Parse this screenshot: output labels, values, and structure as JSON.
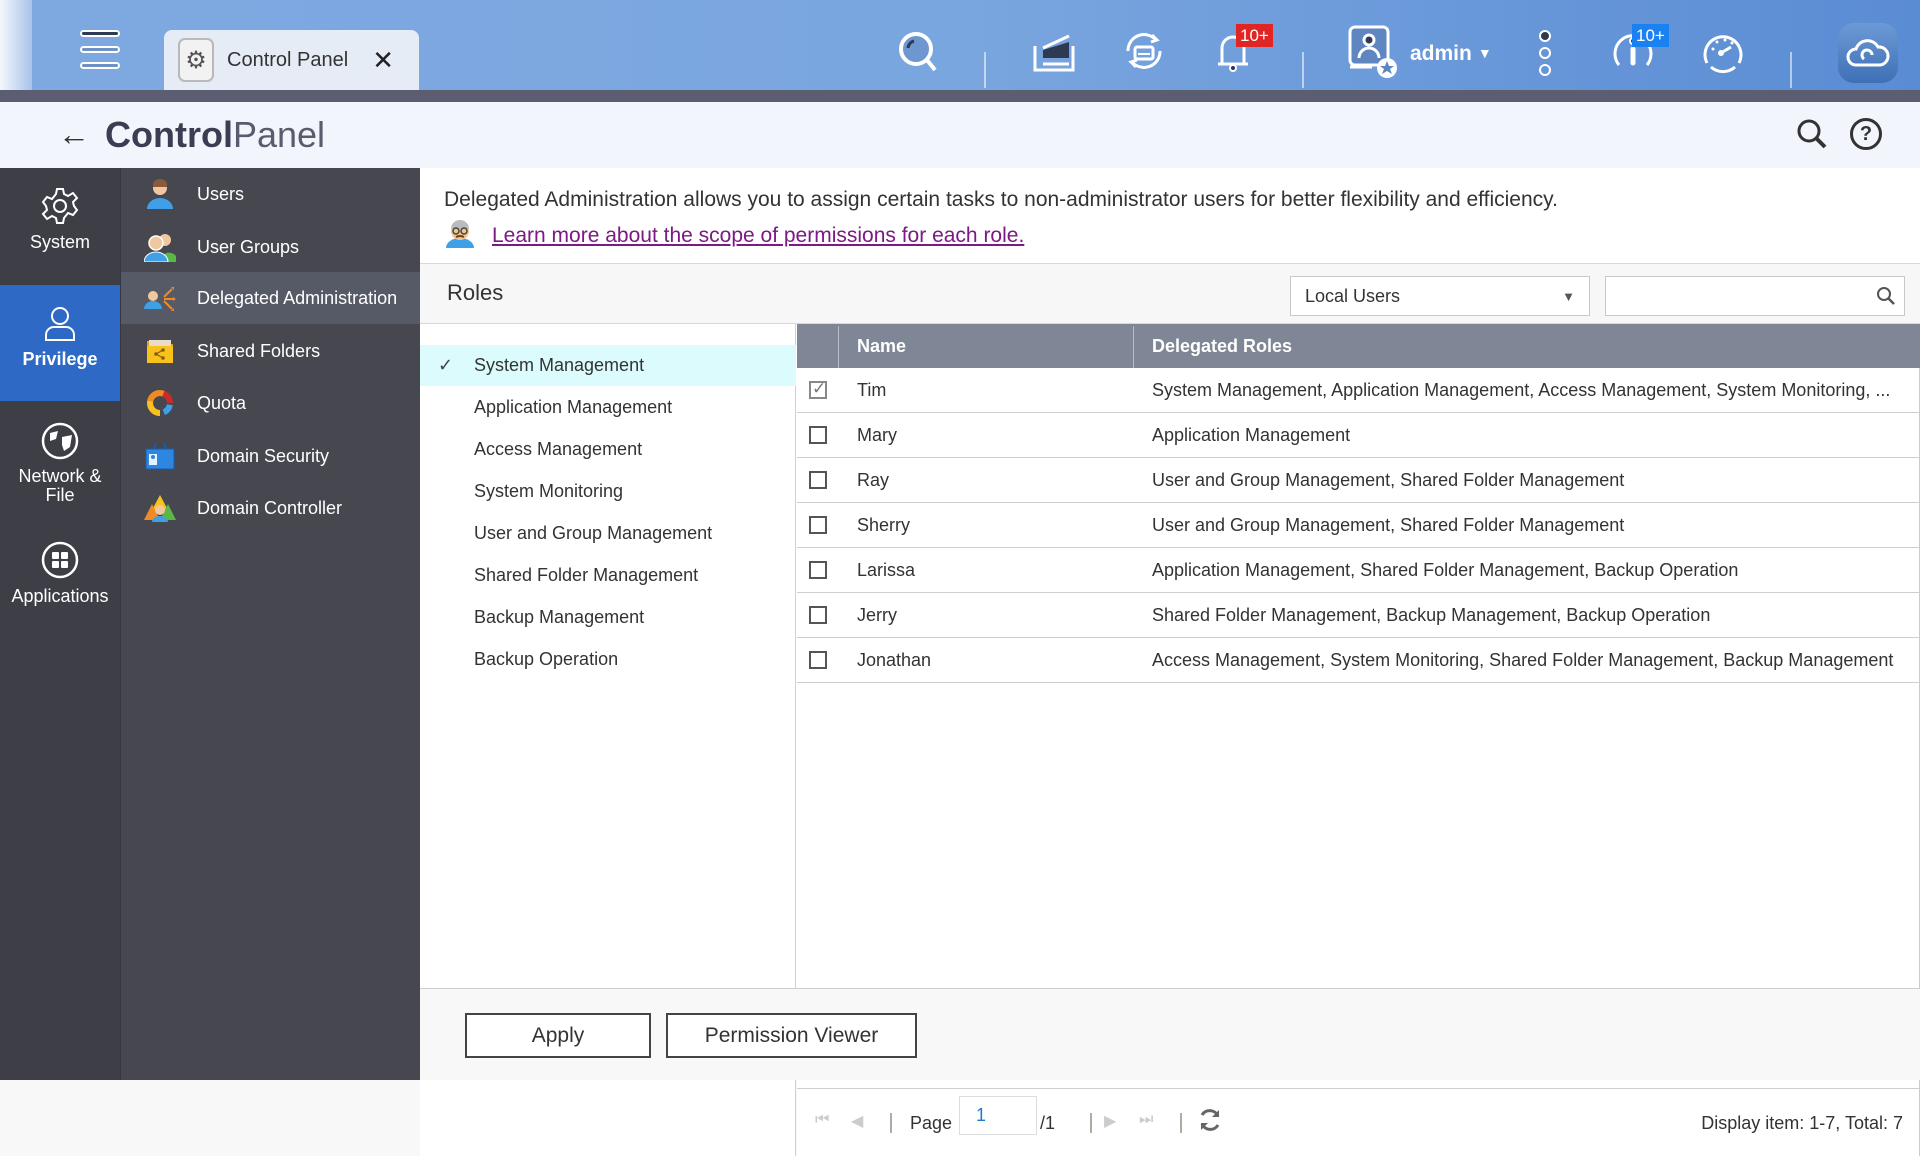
{
  "topbar": {
    "app_tab": {
      "label": "Control Panel",
      "icon": "gear-icon",
      "close_icon": "close-icon"
    },
    "icons": [
      {
        "name": "search-icon"
      },
      {
        "name": "background-tasks-icon"
      },
      {
        "name": "external-device-icon"
      },
      {
        "name": "notifications-icon",
        "badge": "10+",
        "badge_color": "#e02525"
      },
      {
        "name": "user-icon"
      },
      {
        "name": "more-options-icon"
      },
      {
        "name": "info-icon",
        "badge": "10+",
        "badge_color": "#1a82f0"
      },
      {
        "name": "dashboard-icon"
      },
      {
        "name": "cloud-icon"
      }
    ],
    "user": {
      "name": "admin"
    }
  },
  "titlebar": {
    "title_bold": "Control",
    "title_light": "Panel"
  },
  "rail": {
    "items": [
      {
        "label": "System",
        "icon": "gear-icon",
        "active": false
      },
      {
        "label": "Privilege",
        "icon": "user-icon",
        "active": true
      },
      {
        "label": "Network & File",
        "icon": "globe-icon",
        "active": false
      },
      {
        "label": "Applications",
        "icon": "apps-icon",
        "active": false
      }
    ]
  },
  "submenu": {
    "items": [
      {
        "label": "Users",
        "icon": "user-icon",
        "active": false
      },
      {
        "label": "User Groups",
        "icon": "user-groups-icon",
        "active": false
      },
      {
        "label": "Delegated Administration",
        "icon": "delegate-icon",
        "active": true
      },
      {
        "label": "Shared Folders",
        "icon": "shared-folder-icon",
        "active": false
      },
      {
        "label": "Quota",
        "icon": "quota-icon",
        "active": false
      },
      {
        "label": "Domain Security",
        "icon": "domain-security-icon",
        "active": false
      },
      {
        "label": "Domain Controller",
        "icon": "domain-controller-icon",
        "active": false
      }
    ]
  },
  "main": {
    "description": "Delegated Administration allows you to assign certain tasks to non-administrator users for better flexibility and efficiency.",
    "learn_more_link": "Learn more about the scope of permissions for each role.",
    "roles_title": "Roles",
    "user_type_select": {
      "value": "Local Users"
    },
    "search": {
      "value": "",
      "placeholder": ""
    },
    "roles": [
      {
        "label": "System Management",
        "selected": true
      },
      {
        "label": "Application Management",
        "selected": false
      },
      {
        "label": "Access Management",
        "selected": false
      },
      {
        "label": "System Monitoring",
        "selected": false
      },
      {
        "label": "User and Group Management",
        "selected": false
      },
      {
        "label": "Shared Folder Management",
        "selected": false
      },
      {
        "label": "Backup Management",
        "selected": false
      },
      {
        "label": "Backup Operation",
        "selected": false
      }
    ],
    "table": {
      "columns": [
        "Name",
        "Delegated Roles"
      ],
      "rows": [
        {
          "checked": true,
          "name": "Tim",
          "roles": "System Management, Application Management, Access Management, System Monitoring, ..."
        },
        {
          "checked": false,
          "name": "Mary",
          "roles": "Application Management"
        },
        {
          "checked": false,
          "name": "Ray",
          "roles": "User and Group Management, Shared Folder Management"
        },
        {
          "checked": false,
          "name": "Sherry",
          "roles": "User and Group Management, Shared Folder Management"
        },
        {
          "checked": false,
          "name": "Larissa",
          "roles": "Application Management, Shared Folder Management, Backup Operation"
        },
        {
          "checked": false,
          "name": "Jerry",
          "roles": "Shared Folder Management, Backup Management, Backup Operation"
        },
        {
          "checked": false,
          "name": "Jonathan",
          "roles": "Access Management, System Monitoring, Shared Folder Management, Backup Management"
        }
      ]
    },
    "pager": {
      "page_label": "Page",
      "current_page": "1",
      "total_pages": "/1",
      "display_info": "Display item: 1-7, Total: 7"
    },
    "buttons": {
      "apply": "Apply",
      "permission_viewer": "Permission Viewer"
    }
  }
}
